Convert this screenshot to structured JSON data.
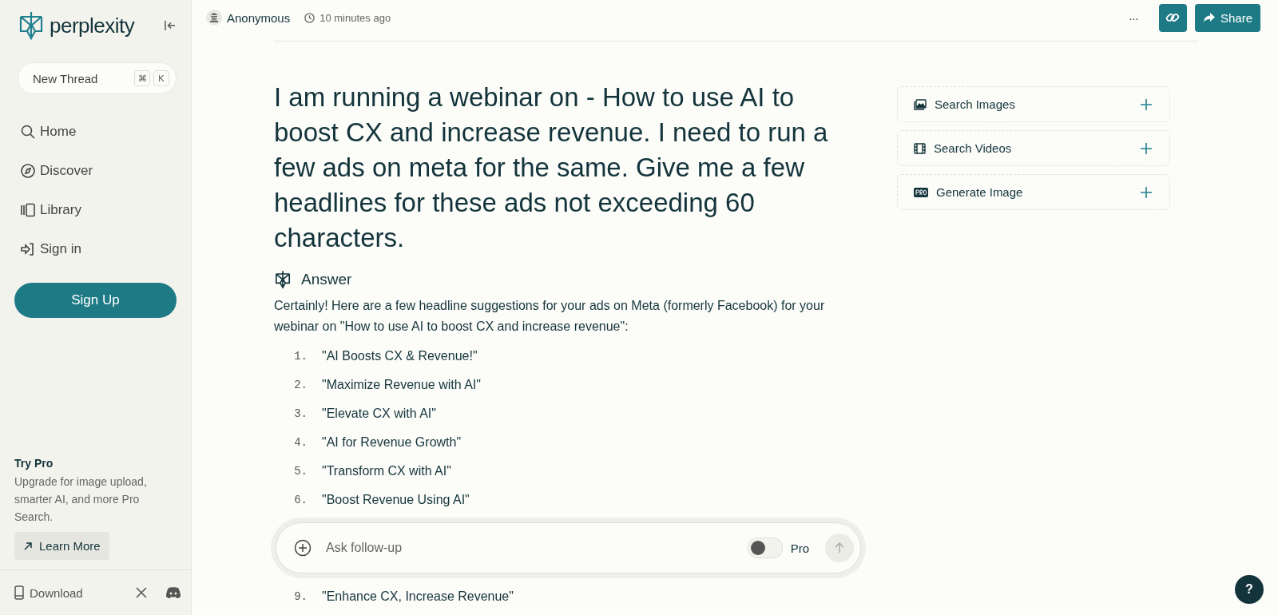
{
  "sidebar": {
    "brand": "perplexity",
    "new_thread": {
      "label": "New Thread",
      "keys": [
        "⌘",
        "K"
      ]
    },
    "nav": [
      {
        "label": "Home"
      },
      {
        "label": "Discover"
      },
      {
        "label": "Library"
      },
      {
        "label": "Sign in"
      }
    ],
    "signup": "Sign Up",
    "promo": {
      "title": "Try Pro",
      "text": "Upgrade for image upload, smarter AI, and more Pro Search.",
      "button": "Learn More"
    },
    "footer": {
      "download": "Download"
    }
  },
  "header": {
    "user": "Anonymous",
    "time": "10 minutes ago",
    "more": "···",
    "share": "Share"
  },
  "question": "I am running a webinar on - How to use AI to boost CX and increase revenue. I need to run a few ads on meta for the same. Give me a few headlines for these ads not exceeding 60 characters.",
  "answer": {
    "title": "Answer",
    "intro": "Certainly! Here are a few headline suggestions for your ads on Meta (formerly Facebook) for your webinar on \"How to use AI to boost CX and increase revenue\":",
    "items": [
      {
        "num": "1.",
        "text": "\"AI Boosts CX & Revenue!\""
      },
      {
        "num": "2.",
        "text": "\"Maximize Revenue with AI\""
      },
      {
        "num": "3.",
        "text": "\"Elevate CX with AI\""
      },
      {
        "num": "4.",
        "text": "\"AI for Revenue Growth\""
      },
      {
        "num": "5.",
        "text": "\"Transform CX with AI\""
      },
      {
        "num": "6.",
        "text": "\"Boost Revenue Using AI\""
      },
      {
        "num": "9.",
        "text": "\"Enhance CX, Increase Revenue\""
      }
    ]
  },
  "followup": {
    "placeholder": "Ask follow-up",
    "pro_label": "Pro",
    "pro": {
      "on": false
    }
  },
  "side_actions": [
    {
      "label": "Search Images"
    },
    {
      "label": "Search Videos"
    },
    {
      "label": "Generate Image"
    }
  ],
  "help": "?"
}
